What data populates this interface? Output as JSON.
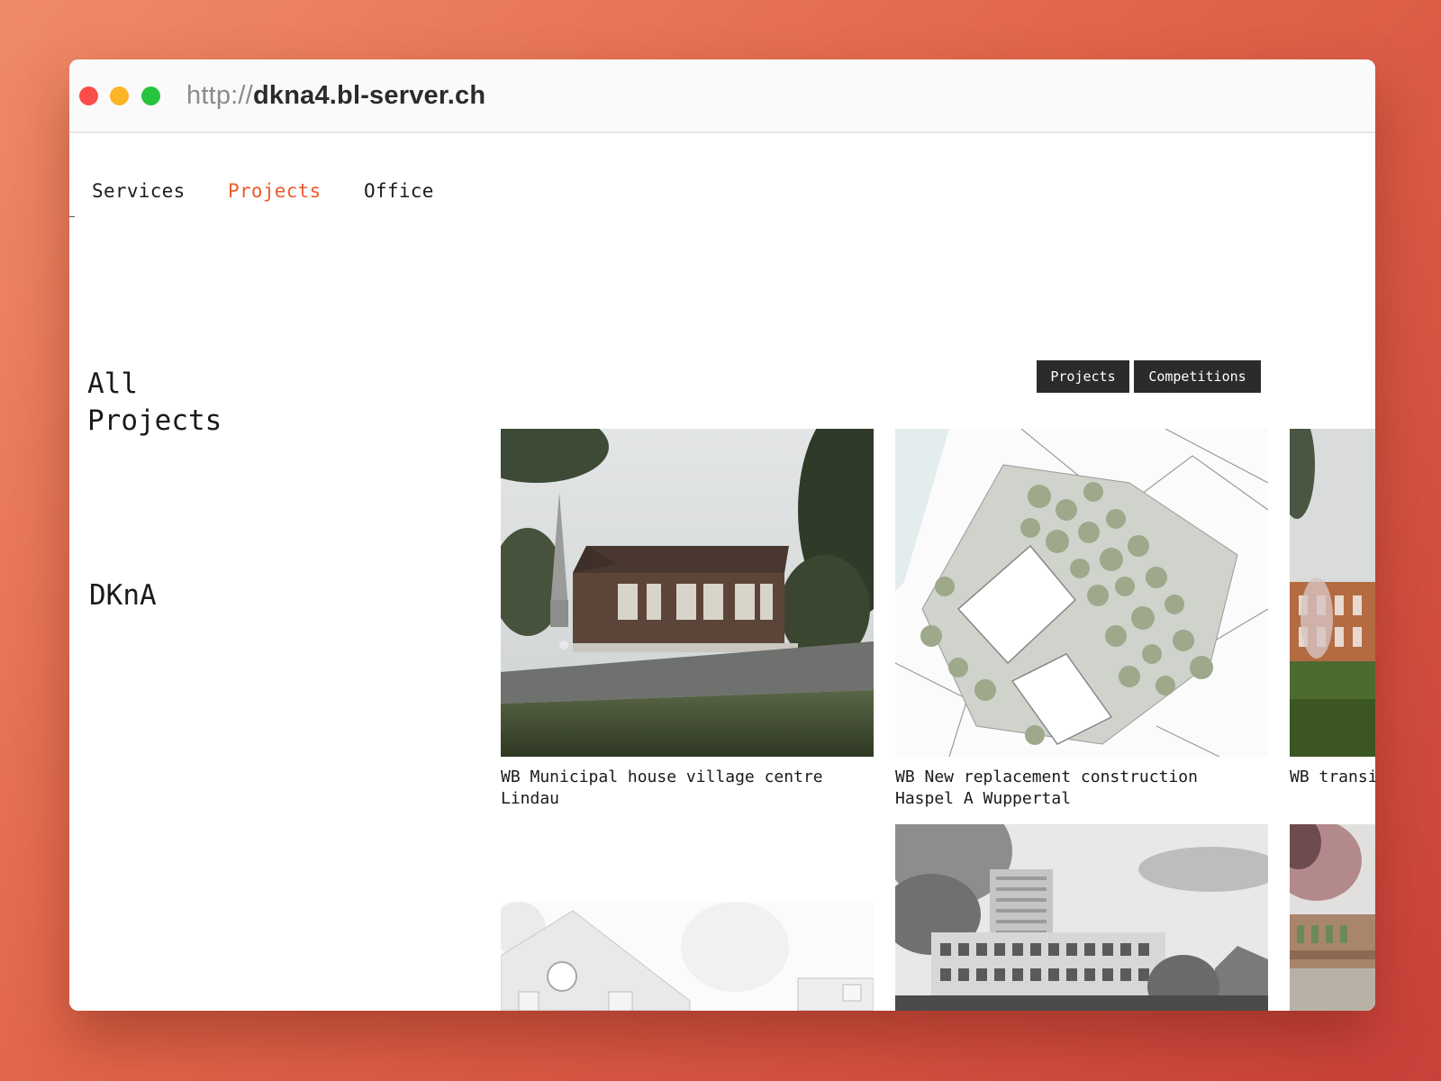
{
  "browser": {
    "url_protocol": "http://",
    "url_host": "dkna4.bl-server.ch"
  },
  "nav": {
    "items": [
      {
        "label": "Services"
      },
      {
        "label": "Projects"
      },
      {
        "label": "Office"
      }
    ],
    "active": "Projects"
  },
  "page": {
    "heading_line1": "All",
    "heading_line2": "Projects",
    "brand": "DKnA"
  },
  "filters": {
    "items": [
      {
        "label": "Projects"
      },
      {
        "label": "Competitions"
      }
    ]
  },
  "projects": [
    {
      "title_line1": "WB Municipal house village centre",
      "title_line2": "Lindau",
      "thumb_icon": "village-house-render-image"
    },
    {
      "title_line1": "WB New replacement construction",
      "title_line2": "Haspel A Wuppertal",
      "thumb_icon": "site-plan-image"
    },
    {
      "title_line1": "WB transi",
      "title_line2": "",
      "thumb_icon": "brick-building-render-image"
    },
    {
      "title_line1": "",
      "title_line2": "",
      "thumb_icon": "gabled-house-sketch-image"
    },
    {
      "title_line1": "",
      "title_line2": "",
      "thumb_icon": "apartment-block-render-image"
    },
    {
      "title_line1": "",
      "title_line2": "",
      "thumb_icon": "blossom-building-render-image"
    }
  ],
  "colors": {
    "accent": "#ee5a2c",
    "background_gradient_start": "#f08a67",
    "background_gradient_end": "#c9413a",
    "filter_button_bg": "#2b2b2b"
  }
}
